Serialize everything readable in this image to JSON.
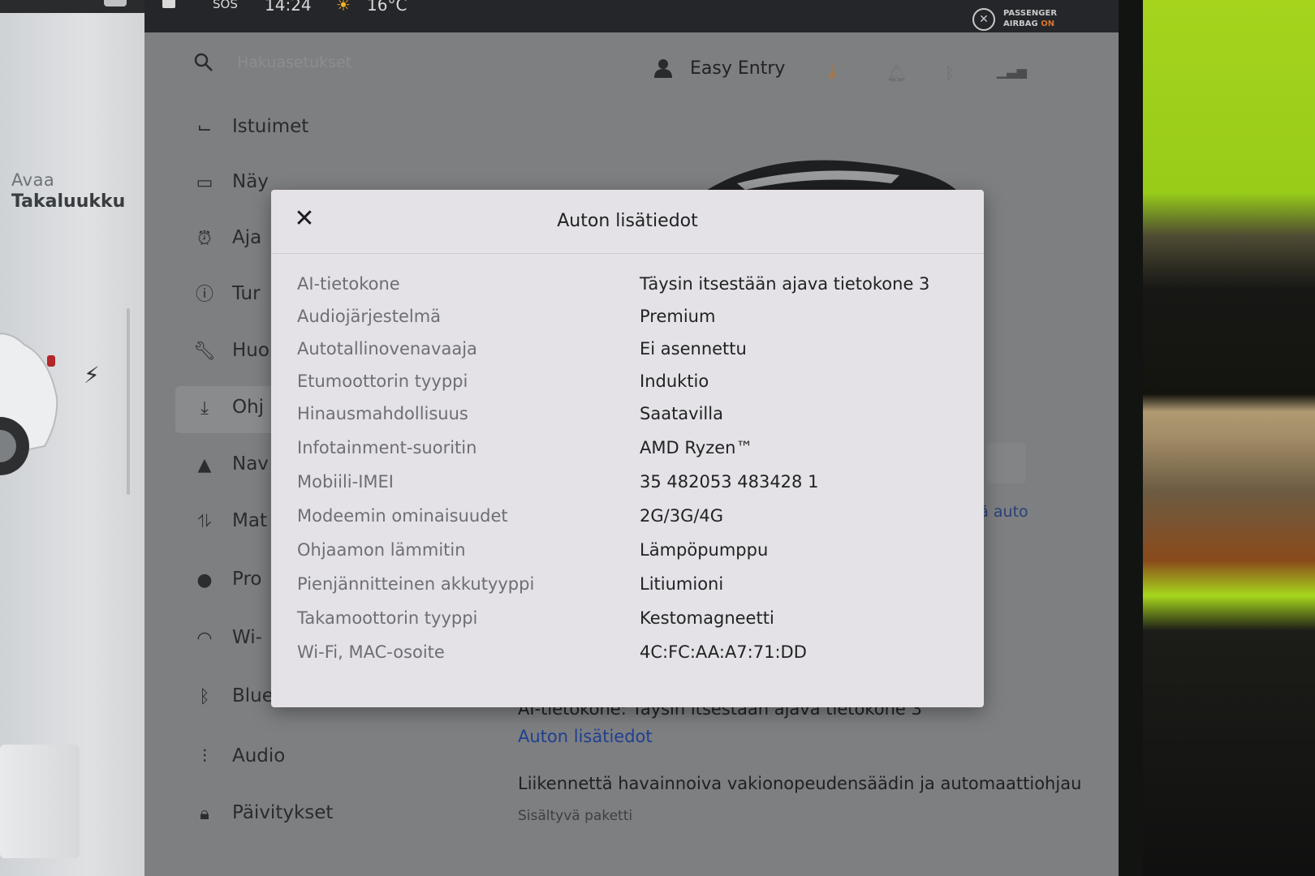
{
  "status": {
    "sos": "SOS",
    "time": "14:24",
    "temperature": "16°C",
    "airbag_line1": "PASSENGER",
    "airbag_line2": "AIRBAG",
    "airbag_state": "ON"
  },
  "left_panel": {
    "trunk_action": "Avaa",
    "trunk_label": "Takaluukku"
  },
  "topbar": {
    "search_placeholder": "Hakuasetukset",
    "profile_name": "Easy Entry"
  },
  "nav": {
    "items": [
      {
        "label": "Istuimet",
        "icon": "seat-icon"
      },
      {
        "label": "Näy",
        "icon": "display-icon"
      },
      {
        "label": "Aja",
        "icon": "alarm-icon"
      },
      {
        "label": "Tur",
        "icon": "safety-icon"
      },
      {
        "label": "Huo",
        "icon": "wrench-icon"
      },
      {
        "label": "Ohj",
        "icon": "download-icon"
      },
      {
        "label": "Nav",
        "icon": "navigation-icon"
      },
      {
        "label": "Mat",
        "icon": "route-icon"
      },
      {
        "label": "Pro",
        "icon": "profile-icon"
      },
      {
        "label": "Wi-",
        "icon": "wifi-icon"
      },
      {
        "label": "Bluetooth",
        "icon": "bluetooth-icon"
      },
      {
        "label": "Audio",
        "icon": "audio-icon"
      },
      {
        "label": "Päivitykset",
        "icon": "lock-icon"
      }
    ]
  },
  "background_info": {
    "link_partial": "meä auto",
    "ai_line": "AI-tietokone: Täysin itsestään ajava tietokone 3",
    "details_link": "Auton lisätiedot",
    "autopilot_line": "Liikennettä havainnoiva vakionopeudensäädin ja automaattiohjau",
    "autopilot_sub": "Sisältyvä paketti"
  },
  "modal": {
    "title": "Auton lisätiedot",
    "rows": [
      {
        "label": "AI-tietokone",
        "value": "Täysin itsestään ajava tietokone 3"
      },
      {
        "label": "Audiojärjestelmä",
        "value": "Premium"
      },
      {
        "label": "Autotallinovenavaaja",
        "value": "Ei asennettu"
      },
      {
        "label": "Etumoottorin tyyppi",
        "value": "Induktio"
      },
      {
        "label": "Hinausmahdollisuus",
        "value": "Saatavilla"
      },
      {
        "label": "Infotainment-suoritin",
        "value": "AMD Ryzen™"
      },
      {
        "label": "Mobiili-IMEI",
        "value": "35 482053 483428 1"
      },
      {
        "label": "Modeemin ominaisuudet",
        "value": "2G/3G/4G"
      },
      {
        "label": "Ohjaamon lämmitin",
        "value": "Lämpöpumppu"
      },
      {
        "label": "Pienjännitteinen akkutyyppi",
        "value": "Litiumioni"
      },
      {
        "label": "Takamoottorin tyyppi",
        "value": "Kestomagneetti"
      },
      {
        "label": "Wi-Fi, MAC-osoite",
        "value": "4C:FC:AA:A7:71:DD"
      }
    ]
  },
  "colors": {
    "accent_orange": "#c6721f",
    "link_blue": "#1e3f92"
  }
}
